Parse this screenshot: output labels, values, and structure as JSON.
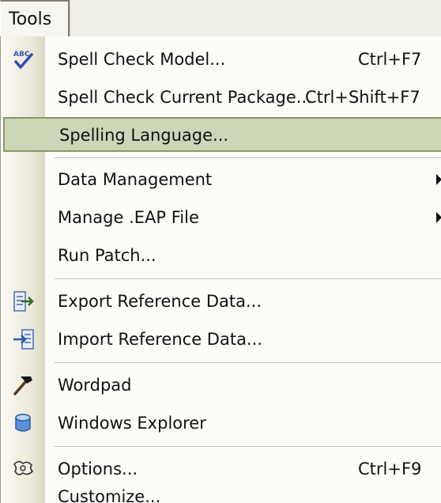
{
  "menubar": {
    "title": "Tools"
  },
  "menu": {
    "items": [
      {
        "label": "Spell Check Model...",
        "shortcut": "Ctrl+F7",
        "icon": "spell-check-icon"
      },
      {
        "label": "Spell Check Current Package...",
        "shortcut": "Ctrl+Shift+F7"
      },
      {
        "label": "Spelling Language...",
        "highlighted": true
      },
      {
        "label": "Data Management",
        "submenu": true
      },
      {
        "label": "Manage .EAP File",
        "submenu": true
      },
      {
        "label": "Run Patch..."
      },
      {
        "label": "Export Reference Data...",
        "icon": "export-data-icon"
      },
      {
        "label": "Import Reference Data...",
        "icon": "import-data-icon"
      },
      {
        "label": "Wordpad",
        "icon": "hammer-icon"
      },
      {
        "label": "Windows Explorer",
        "icon": "explorer-icon"
      },
      {
        "label": "Options...",
        "shortcut": "Ctrl+F9",
        "icon": "options-icon"
      },
      {
        "label": "Customize..."
      }
    ]
  },
  "colors": {
    "highlight_fill": "#ccd7b8",
    "highlight_border": "#8a9665",
    "menu_background": "#fcfcf9"
  }
}
